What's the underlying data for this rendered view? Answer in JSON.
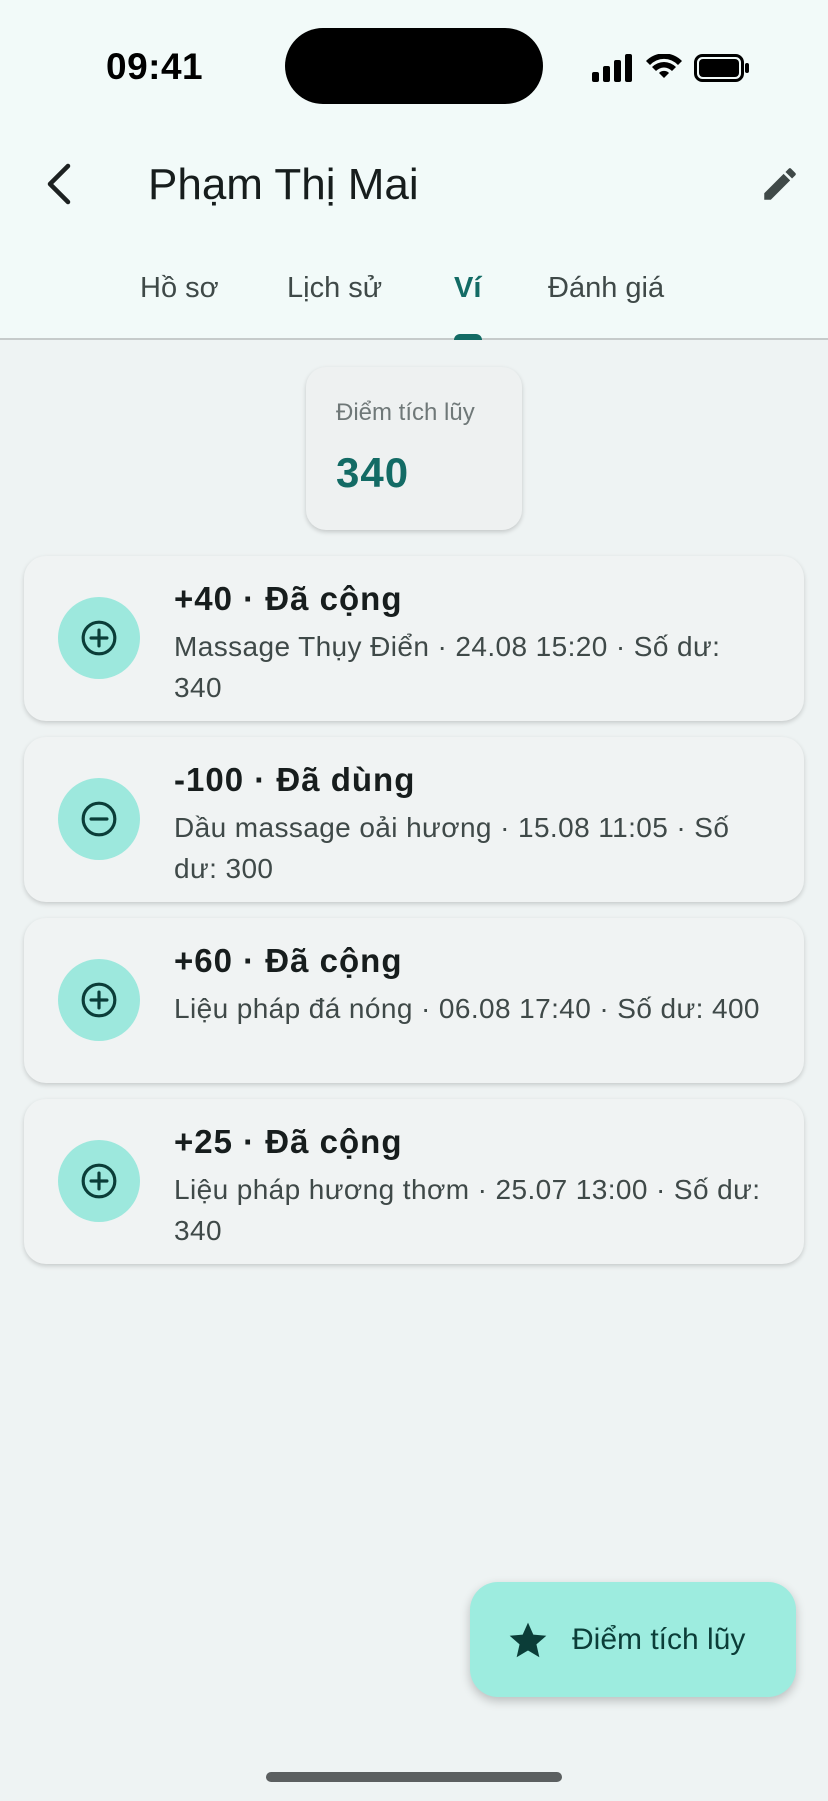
{
  "status_bar": {
    "time": "09:41"
  },
  "header": {
    "title": "Phạm Thị Mai"
  },
  "tabs": [
    {
      "label": "Hồ sơ",
      "active": false
    },
    {
      "label": "Lịch sử",
      "active": false
    },
    {
      "label": "Ví",
      "active": true
    },
    {
      "label": "Đánh giá",
      "active": false
    }
  ],
  "points_summary": {
    "label": "Điểm tích lũy",
    "value": "340"
  },
  "transactions": [
    {
      "title": "+40 · Đã cộng",
      "detail": "Massage Thụy Điển · 24.08 15:20 · Số dư: 340",
      "icon": "plus-circle-icon"
    },
    {
      "title": "-100 · Đã dùng",
      "detail": "Dầu massage oải hương · 15.08 11:05 · Số dư: 300",
      "icon": "minus-circle-icon"
    },
    {
      "title": "+60 · Đã cộng",
      "detail": "Liệu pháp đá nóng · 06.08 17:40 · Số dư: 400",
      "icon": "plus-circle-icon"
    },
    {
      "title": "+25 · Đã cộng",
      "detail": "Liệu pháp hương thơm · 25.07 13:00 · Số dư: 340",
      "icon": "plus-circle-icon"
    }
  ],
  "fab": {
    "label": "Điểm tích lũy",
    "icon": "star-icon"
  },
  "colors": {
    "accent": "#136b65",
    "avatar_bg": "#9de8dd",
    "fab_bg": "#9decdf"
  }
}
